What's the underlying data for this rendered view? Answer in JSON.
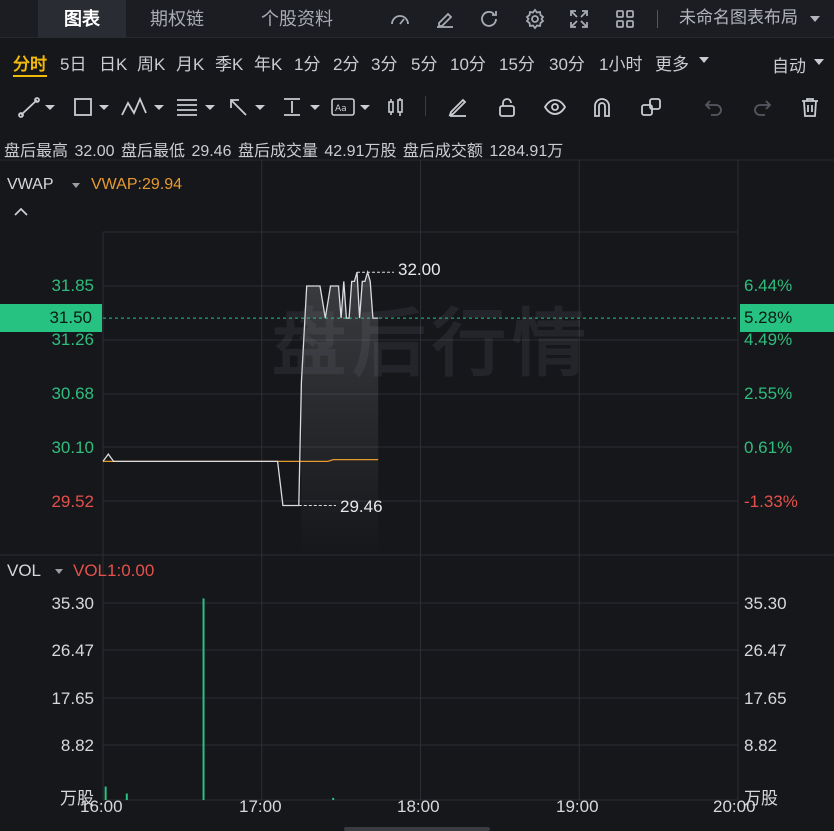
{
  "top_tabs": [
    {
      "label": "图表",
      "active": true
    },
    {
      "label": "期权链",
      "active": false
    },
    {
      "label": "个股资料",
      "active": false
    }
  ],
  "top_icons": [
    "gauge-icon",
    "edit-icon",
    "refresh-icon",
    "settings-gear-icon",
    "fullscreen-icon",
    "grid-layout-icon"
  ],
  "layout_name": "未命名图表布局",
  "periods": [
    "分时",
    "5日",
    "日K",
    "周K",
    "月K",
    "季K",
    "年K",
    "1分",
    "2分",
    "3分",
    "5分",
    "10分",
    "15分",
    "30分",
    "1小时",
    "更多"
  ],
  "active_period": "分时",
  "mode_select": "自动",
  "toolbar_icons": [
    "line-tool-icon",
    "rectangle-tool-icon",
    "pattern-tool-icon",
    "fib-tool-icon",
    "arrow-tool-icon",
    "measure-tool-icon",
    "text-tool-icon",
    "candle-tool-icon",
    "pencil-icon",
    "lock-icon",
    "eye-icon",
    "magnet-icon",
    "link-icon",
    "undo-icon",
    "redo-icon",
    "trash-icon"
  ],
  "stats": {
    "high_label": "盘后最高",
    "high_value": "32.00",
    "low_label": "盘后最低",
    "low_value": "29.46",
    "volume_label": "盘后成交量",
    "volume_value": "42.91万股",
    "amount_label": "盘后成交额",
    "amount_value": "1284.91万"
  },
  "main_indicator": {
    "name": "VWAP",
    "value_text": "VWAP:29.94"
  },
  "price_axis": {
    "left_labels": [
      {
        "text": "31.85",
        "color": "green"
      },
      {
        "text": "31.26",
        "color": "green"
      },
      {
        "text": "30.68",
        "color": "green"
      },
      {
        "text": "30.10",
        "color": "green"
      },
      {
        "text": "29.52",
        "color": "red"
      }
    ],
    "right_labels": [
      {
        "text": "6.44%",
        "color": "green"
      },
      {
        "text": "4.49%",
        "color": "green"
      },
      {
        "text": "2.55%",
        "color": "green"
      },
      {
        "text": "0.61%",
        "color": "green"
      },
      {
        "text": "-1.33%",
        "color": "red"
      }
    ],
    "current_price": "31.50",
    "current_pct": "5.28%"
  },
  "hi_marker": "32.00",
  "lo_marker": "29.46",
  "watermark": "盘后行情",
  "vol_indicator": {
    "name": "VOL",
    "value_text": "VOL1:0.00"
  },
  "vol_axis": {
    "labels": [
      "35.30",
      "26.47",
      "17.65",
      "8.82"
    ],
    "unit": "万股"
  },
  "time_axis": [
    "16:00",
    "17:00",
    "18:00",
    "19:00",
    "20:00"
  ],
  "colors": {
    "up": "#2fbd7d",
    "down": "#e4514c",
    "vwap": "#e69a2e",
    "accent": "#f0b90b",
    "price_tag": "#26c281"
  },
  "chart_data": {
    "type": "line",
    "price_series": [
      {
        "t": "16:00",
        "v": 29.94
      },
      {
        "t": "16:02",
        "v": 30.02
      },
      {
        "t": "16:04",
        "v": 29.94
      },
      {
        "t": "17:06",
        "v": 29.94
      },
      {
        "t": "17:08",
        "v": 29.46
      },
      {
        "t": "17:14",
        "v": 29.46
      },
      {
        "t": "17:15",
        "v": 30.8
      },
      {
        "t": "17:17",
        "v": 31.85
      },
      {
        "t": "17:22",
        "v": 31.85
      },
      {
        "t": "17:24",
        "v": 31.5
      },
      {
        "t": "17:26",
        "v": 31.85
      },
      {
        "t": "17:29",
        "v": 31.85
      },
      {
        "t": "17:30",
        "v": 31.5
      },
      {
        "t": "17:31",
        "v": 31.9
      },
      {
        "t": "17:32",
        "v": 31.5
      },
      {
        "t": "17:33",
        "v": 31.5
      },
      {
        "t": "17:34",
        "v": 31.9
      },
      {
        "t": "17:35",
        "v": 31.9
      },
      {
        "t": "17:36",
        "v": 32.0
      },
      {
        "t": "17:37",
        "v": 31.5
      },
      {
        "t": "17:38",
        "v": 31.9
      },
      {
        "t": "17:39",
        "v": 31.9
      },
      {
        "t": "17:40",
        "v": 32.0
      },
      {
        "t": "17:41",
        "v": 31.9
      },
      {
        "t": "17:42",
        "v": 31.5
      },
      {
        "t": "17:44",
        "v": 31.5
      }
    ],
    "vwap_series": [
      {
        "t": "16:00",
        "v": 29.94
      },
      {
        "t": "17:25",
        "v": 29.94
      },
      {
        "t": "17:27",
        "v": 29.96
      },
      {
        "t": "17:44",
        "v": 29.96
      }
    ],
    "volume_bars": [
      {
        "t": "16:01",
        "v": 2.5
      },
      {
        "t": "16:09",
        "v": 1.2
      },
      {
        "t": "16:38",
        "v": 37.5
      },
      {
        "t": "17:27",
        "v": 0.4
      }
    ],
    "price_range": [
      29.3,
      32.25
    ],
    "volume_range": [
      0,
      40
    ],
    "time_range": [
      "16:00",
      "20:00"
    ],
    "grid": true
  }
}
